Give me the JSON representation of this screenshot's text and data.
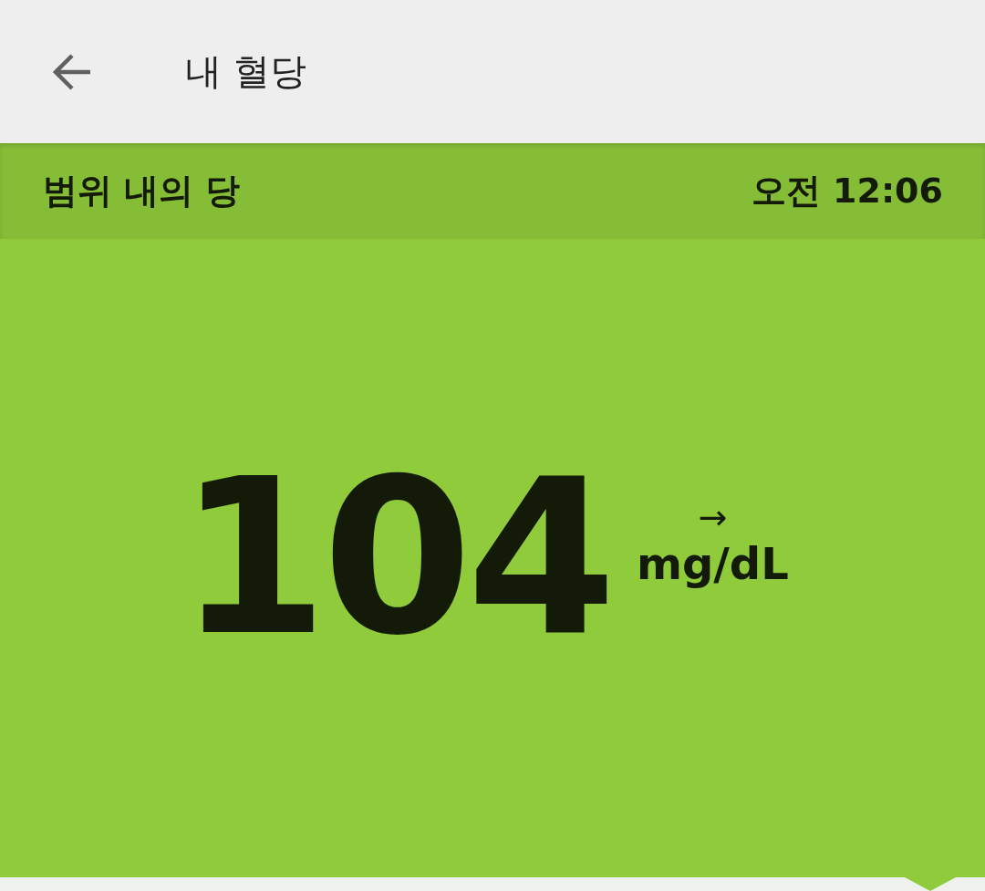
{
  "app_bar": {
    "title": "내 혈당"
  },
  "status_header": {
    "label": "범위 내의 당",
    "time": "오전 12:06"
  },
  "reading": {
    "value": "104",
    "trend_arrow": "→",
    "unit": "mg/dL"
  }
}
